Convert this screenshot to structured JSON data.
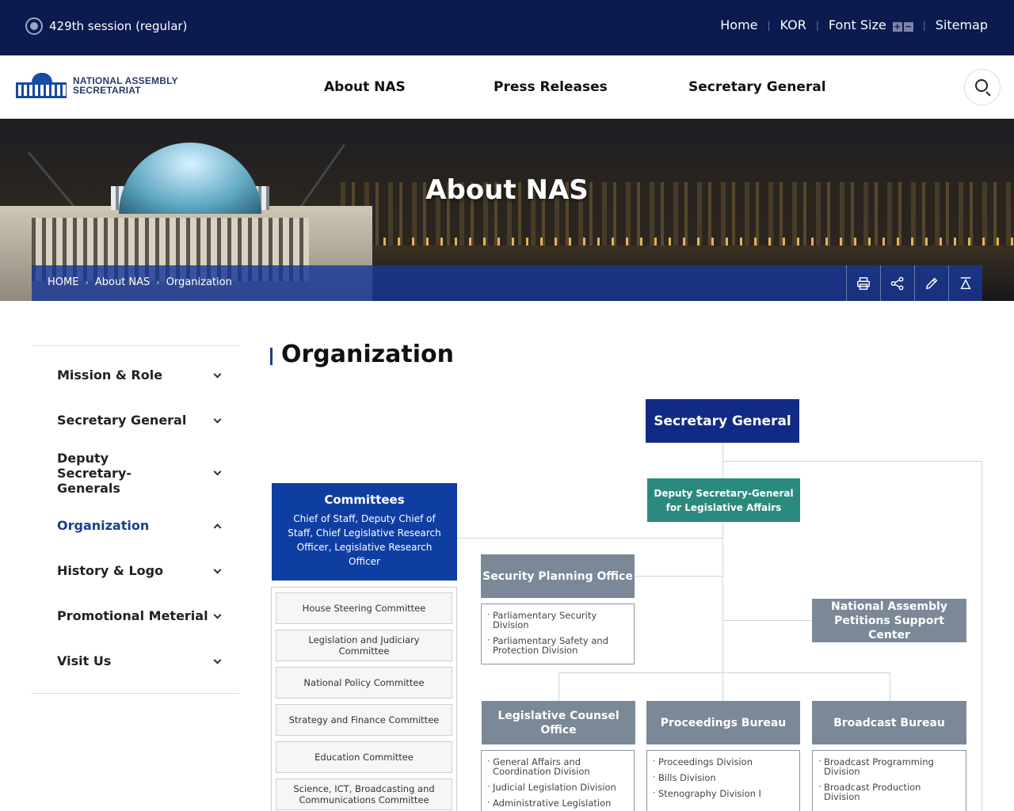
{
  "topbar": {
    "session": "429th session (regular)",
    "links": {
      "home": "Home",
      "lang": "KOR",
      "font_size": "Font Size",
      "plus": "+",
      "minus": "−",
      "sitemap": "Sitemap"
    }
  },
  "header": {
    "logo_line1": "NATIONAL ASSEMBLY",
    "logo_line2": "SECRETARIAT",
    "nav": [
      "About NAS",
      "Press Releases",
      "Secretary General"
    ]
  },
  "hero": {
    "title": "About NAS",
    "breadcrumb": [
      "HOME",
      "About NAS",
      "Organization"
    ]
  },
  "sidebar": {
    "items": [
      {
        "label": "Mission & Role"
      },
      {
        "label": "Secretary General"
      },
      {
        "label": "Deputy Secretary-Generals"
      },
      {
        "label": "Organization"
      },
      {
        "label": "History & Logo"
      },
      {
        "label": "Promotional Meterial"
      },
      {
        "label": "Visit Us"
      }
    ],
    "active": "Organization"
  },
  "main": {
    "title": "Organization",
    "org": {
      "secretary_general": "Secretary General",
      "deputy": "Deputy Secretary-General for Legislative Affairs",
      "committees_title": "Committees",
      "committees_desc": "Chief of Staff, Deputy Chief of Staff, Chief Legislative Research Officer, Legislative Research Officer",
      "committees": [
        "House Steering Committee",
        "Legislation and Judiciary Committee",
        "National Policy Committee",
        "Strategy and Finance Committee",
        "Education Committee",
        "Science, ICT, Broadcasting and Communications Committee"
      ],
      "security_office": "Security Planning Office",
      "security_divisions": [
        "Parliamentary Security Division",
        "Parliamentary Safety and Protection Division"
      ],
      "petitions_center": "National Assembly Petitions Support Center",
      "legislative_counsel": "Legislative Counsel Office",
      "legislative_divisions": [
        "General Affairs and Coordination Division",
        "Judicial Legislation Division",
        "Administrative Legislation"
      ],
      "proceedings": "Proceedings Bureau",
      "proceedings_divisions": [
        "Proceedings Division",
        "Bills Division",
        "Stenography Division I"
      ],
      "broadcast": "Broadcast Bureau",
      "broadcast_divisions": [
        "Broadcast Programming Division",
        "Broadcast Production Division"
      ]
    }
  },
  "colors": {
    "topbar": "#0b1a4f",
    "accent": "#1a3f8f",
    "secretary": "#102a86",
    "deputy": "#2a8a7e",
    "bureau": "#7b8898",
    "committees": "#0f3ea3"
  }
}
